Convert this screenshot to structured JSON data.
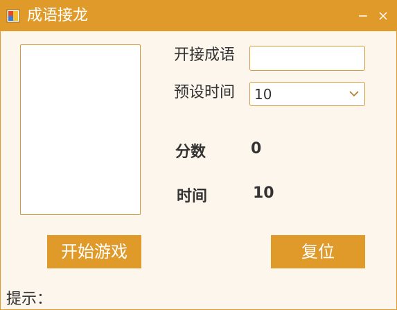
{
  "window": {
    "title": "成语接龙",
    "accent_color": "#e09a2a",
    "background_color": "#fdf6ec"
  },
  "title_icons": {
    "app": "app-icon",
    "minimize": "minimize-icon",
    "close": "close-icon"
  },
  "idiom_list": {
    "items": []
  },
  "start_idiom": {
    "label": "开接成语",
    "value": ""
  },
  "preset_time": {
    "label": "预设时间",
    "selected": "10",
    "icon": "chevron-down-icon"
  },
  "score": {
    "label": "分数",
    "value": "0"
  },
  "time": {
    "label": "时间",
    "value": "10"
  },
  "buttons": {
    "start": "开始游戏",
    "reset": "复位"
  },
  "hint": {
    "label": "提示："
  }
}
